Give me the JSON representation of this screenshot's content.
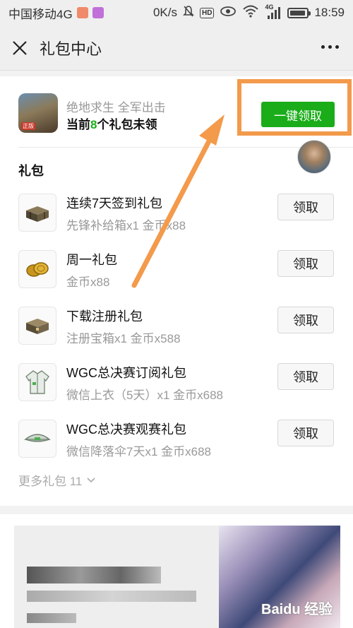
{
  "status_bar": {
    "carrier": "中国移动4G",
    "speed": "0K/s",
    "hd": "HD",
    "network": "4G",
    "time": "18:59",
    "battery_level": 0.8
  },
  "header": {
    "title": "礼包中心"
  },
  "game": {
    "icon_badge": "正版",
    "name": "绝地求生 全军出击",
    "pending_prefix": "当前",
    "pending_count": "8",
    "pending_suffix": "个礼包未领"
  },
  "claim_all_label": "一键领取",
  "section_label": "礼包",
  "gifts": [
    {
      "title": "连续7天签到礼包",
      "desc": "先锋补给箱x1 金币x88",
      "button": "领取",
      "icon": "supply-crate-icon"
    },
    {
      "title": "周一礼包",
      "desc": "金币x88",
      "button": "领取",
      "icon": "gold-coins-icon"
    },
    {
      "title": "下载注册礼包",
      "desc": "注册宝箱x1 金币x588",
      "button": "领取",
      "icon": "treasure-chest-icon"
    },
    {
      "title": "WGC总决赛订阅礼包",
      "desc": "微信上衣（5天）x1 金币x688",
      "button": "领取",
      "icon": "jacket-icon"
    },
    {
      "title": "WGC总决赛观赛礼包",
      "desc": "微信降落伞7天x1 金币x688",
      "button": "领取",
      "icon": "parachute-icon"
    }
  ],
  "more_gifts_label": "更多礼包 11",
  "watermark": "Baidu 经验",
  "colors": {
    "accent": "#1aad19",
    "highlight": "#f39a4b"
  }
}
